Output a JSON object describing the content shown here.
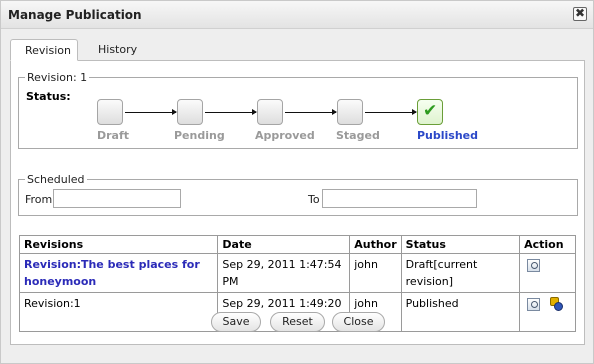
{
  "dialog": {
    "title": "Manage Publication",
    "close_glyph": "✖"
  },
  "tabs": [
    {
      "label": "Revision"
    },
    {
      "label": "History"
    }
  ],
  "revision_box": {
    "legend": "Revision: 1",
    "status_label": "Status:",
    "steps": [
      {
        "label": "Draft",
        "state": "incomplete"
      },
      {
        "label": "Pending",
        "state": "incomplete"
      },
      {
        "label": "Approved",
        "state": "incomplete"
      },
      {
        "label": "Staged",
        "state": "incomplete"
      },
      {
        "label": "Published",
        "state": "current",
        "icon": "checkmark-icon"
      }
    ]
  },
  "scheduled_box": {
    "legend": "Scheduled",
    "from_label": "From",
    "from_value": "",
    "to_label": "To",
    "to_value": ""
  },
  "revisions_table": {
    "headers": [
      "Revisions",
      "Date",
      "Author",
      "Status",
      "Action"
    ],
    "rows": [
      {
        "revision": "Revision:The best places for honeymoon",
        "date": "Sep 29, 2011 1:47:54 PM",
        "author": "john",
        "status": "Draft[current revision]",
        "actions": [
          "view-icon"
        ]
      },
      {
        "revision": "Revision:1",
        "date": "Sep 29, 2011 1:49:20 PM",
        "author": "john",
        "status": "Published",
        "actions": [
          "view-icon",
          "publish-icon"
        ]
      }
    ]
  },
  "buttons": {
    "save": "Save",
    "reset": "Reset",
    "close": "Close"
  },
  "colors": {
    "published_accent": "#2b48c8",
    "checkmark": "#2e9b1f",
    "link": "#2b2bb8",
    "inactive_step": "#9a9a9a"
  }
}
